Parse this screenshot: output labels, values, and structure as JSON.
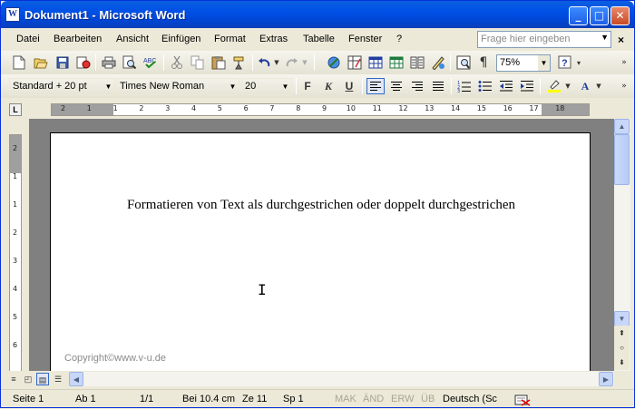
{
  "window": {
    "title": "Dokument1 - Microsoft Word",
    "app_icon": "W"
  },
  "caption_buttons": {
    "minimize": "_",
    "maximize": "□",
    "close": "✕"
  },
  "menu": {
    "items": [
      "Datei",
      "Bearbeiten",
      "Ansicht",
      "Einfügen",
      "Format",
      "Extras",
      "Tabelle",
      "Fenster",
      "?"
    ],
    "help_placeholder": "Frage hier eingeben",
    "close_doc": "×"
  },
  "toolbar_standard": {
    "zoom": "75%"
  },
  "toolbar_format": {
    "style": "Standard + 20 pt",
    "font": "Times New Roman",
    "size": "20",
    "bold": "F",
    "italic": "K",
    "underline": "U",
    "text_color_glyph": "A"
  },
  "ruler": {
    "tab_selector": "L",
    "h_marks": [
      "2",
      "1",
      "1",
      "2",
      "3",
      "4",
      "5",
      "6",
      "7",
      "8",
      "9",
      "10",
      "11",
      "12",
      "13",
      "14",
      "15",
      "16",
      "17",
      "18"
    ],
    "v_marks": [
      "2",
      "1",
      "1",
      "2",
      "3",
      "4",
      "5",
      "6"
    ]
  },
  "document": {
    "text": "Formatieren von Text als durchgestrichen oder doppelt durchgestrichen",
    "copyright": "Copyright©www.v-u.de"
  },
  "status": {
    "page": "Seite  1",
    "section": "Ab  1",
    "pages": "1/1",
    "at": "Bei  10.4 cm",
    "line": "Ze  11",
    "col": "Sp  1",
    "rec": "MAK",
    "trk": "ÄND",
    "ext": "ERW",
    "ovr": "ÜB",
    "language": "Deutsch (Sc"
  }
}
